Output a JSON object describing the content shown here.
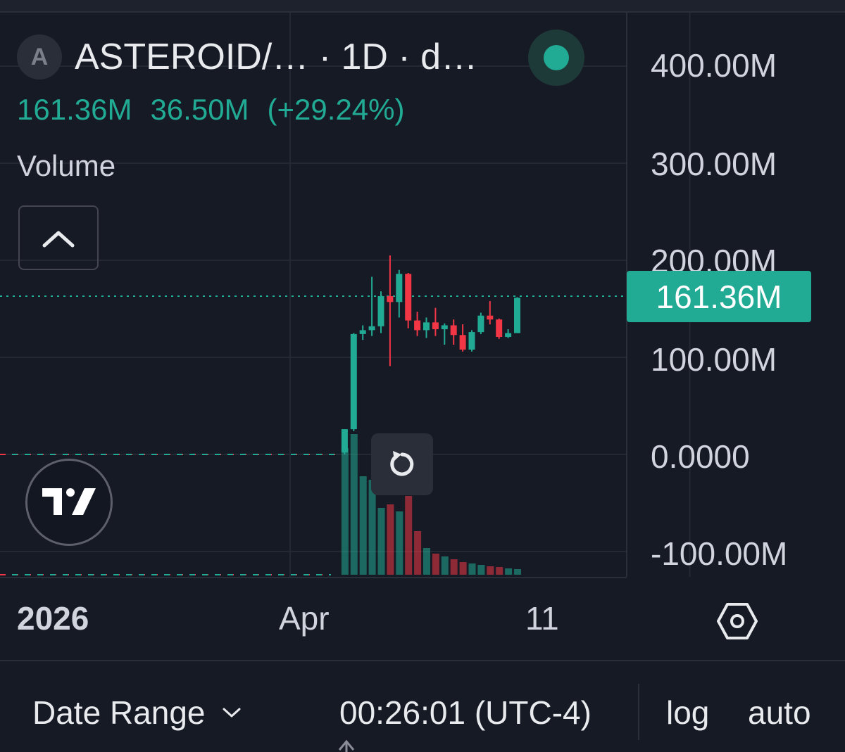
{
  "legend": {
    "avatar_letter": "A",
    "title": "ASTEROID/… · 1D · d…",
    "close_value": "161.36M",
    "change_value": "36.50M",
    "change_pct": "(+29.24%)",
    "volume_label": "Volume"
  },
  "price_label": "161.36M",
  "bottom": {
    "date_range": "Date Range",
    "clock": "00:26:01 (UTC-4)",
    "log": "log",
    "auto": "auto"
  },
  "colors": {
    "up": "#22ab94",
    "down": "#f23645",
    "background": "#161a25",
    "grid": "#242833"
  },
  "chart_data": {
    "type": "candlestick",
    "interval": "1D",
    "ylim": [
      -110000000,
      425000000
    ],
    "y_ticks": [
      "400.00M",
      "300.00M",
      "200.00M",
      "100.00M",
      "0.0000",
      "-100.00M"
    ],
    "y_tick_values": [
      400000000,
      300000000,
      200000000,
      100000000,
      0,
      -100000000
    ],
    "x_ticks": [
      {
        "label": "2026",
        "index": -53,
        "bold": true
      },
      {
        "label": "Apr",
        "index": -5,
        "bold": false
      },
      {
        "label": "11",
        "index": 39,
        "bold": false
      }
    ],
    "last_price": 161360000,
    "candles": [
      {
        "o": 0,
        "h": 0,
        "l": 0,
        "c": 0,
        "v": 0
      },
      {
        "o": 2000000,
        "h": 26000000,
        "l": 0,
        "c": 26000000,
        "v": 180
      },
      {
        "o": 26000000,
        "h": 125000000,
        "l": 24000000,
        "c": 124000000,
        "v": 200
      },
      {
        "o": 124000000,
        "h": 133000000,
        "l": 118000000,
        "c": 128000000,
        "v": 140
      },
      {
        "o": 128000000,
        "h": 183000000,
        "l": 122000000,
        "c": 132000000,
        "v": 135
      },
      {
        "o": 132000000,
        "h": 168000000,
        "l": 125000000,
        "c": 163000000,
        "v": 95
      },
      {
        "o": 163000000,
        "h": 205000000,
        "l": 91000000,
        "c": 157000000,
        "v": 100
      },
      {
        "o": 157000000,
        "h": 190000000,
        "l": 141000000,
        "c": 186000000,
        "v": 90
      },
      {
        "o": 186000000,
        "h": 187000000,
        "l": 130000000,
        "c": 138000000,
        "v": 112
      },
      {
        "o": 138000000,
        "h": 147000000,
        "l": 122000000,
        "c": 128000000,
        "v": 62
      },
      {
        "o": 128000000,
        "h": 141000000,
        "l": 120000000,
        "c": 136000000,
        "v": 38
      },
      {
        "o": 136000000,
        "h": 151000000,
        "l": 122000000,
        "c": 129000000,
        "v": 30
      },
      {
        "o": 129000000,
        "h": 135000000,
        "l": 113000000,
        "c": 133000000,
        "v": 26
      },
      {
        "o": 133000000,
        "h": 139000000,
        "l": 113000000,
        "c": 123000000,
        "v": 22
      },
      {
        "o": 123000000,
        "h": 134000000,
        "l": 106000000,
        "c": 108000000,
        "v": 18
      },
      {
        "o": 108000000,
        "h": 128000000,
        "l": 106000000,
        "c": 126000000,
        "v": 16
      },
      {
        "o": 126000000,
        "h": 146000000,
        "l": 124000000,
        "c": 143000000,
        "v": 14
      },
      {
        "o": 143000000,
        "h": 158000000,
        "l": 134000000,
        "c": 139000000,
        "v": 12
      },
      {
        "o": 139000000,
        "h": 140000000,
        "l": 119000000,
        "c": 121000000,
        "v": 11
      },
      {
        "o": 121000000,
        "h": 129000000,
        "l": 120000000,
        "c": 125000000,
        "v": 9
      },
      {
        "o": 125000000,
        "h": 162000000,
        "l": 125000000,
        "c": 161360000,
        "v": 8
      }
    ]
  }
}
